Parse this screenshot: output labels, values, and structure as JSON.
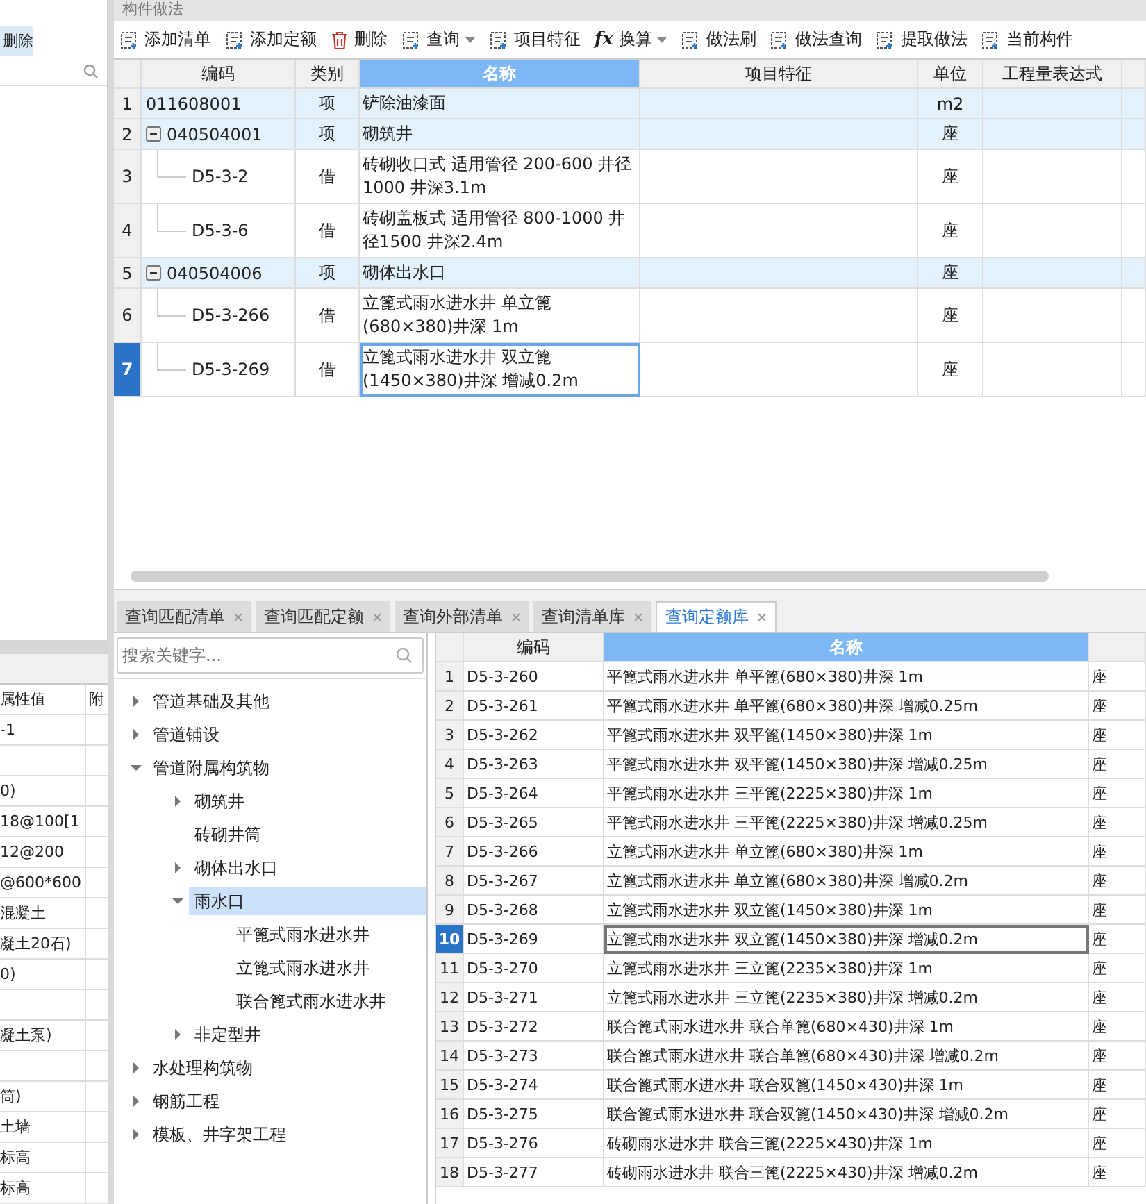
{
  "left_panel": {
    "delete_button": "删除",
    "property_table": {
      "columns": [
        "属性值",
        "附"
      ],
      "rows": [
        {
          "value": "-1"
        },
        {},
        {
          "value": "0)"
        },
        {
          "value": "18@100[1"
        },
        {
          "value": "12@200"
        },
        {
          "value": "@600*600"
        },
        {
          "value": "混凝土"
        },
        {
          "value": "凝土20石)"
        },
        {
          "value": "0)"
        },
        {},
        {
          "value": "凝土泵)"
        },
        {},
        {
          "value": "筒)"
        },
        {
          "value": "土墙"
        },
        {
          "value": "标高"
        },
        {
          "value": "标高"
        }
      ]
    }
  },
  "section_title": "构件做法",
  "toolbar": [
    {
      "label": "添加清单",
      "dropdown": false
    },
    {
      "label": "添加定额",
      "dropdown": false
    },
    {
      "label": "删除",
      "dropdown": false
    },
    {
      "label": "查询",
      "dropdown": true
    },
    {
      "label": "项目特征",
      "dropdown": false
    },
    {
      "label": "换算",
      "glyph": "fx",
      "dropdown": true
    },
    {
      "label": "做法刷",
      "dropdown": false
    },
    {
      "label": "做法查询",
      "dropdown": false
    },
    {
      "label": "提取做法",
      "dropdown": false
    },
    {
      "label": "当前构件",
      "dropdown": false
    }
  ],
  "grid": {
    "columns": [
      {
        "label": "编码",
        "selected": false
      },
      {
        "label": "类别",
        "selected": false
      },
      {
        "label": "名称",
        "selected": true
      },
      {
        "label": "项目特征",
        "selected": false
      },
      {
        "label": "单位",
        "selected": false
      },
      {
        "label": "工程量表达式",
        "selected": false
      }
    ],
    "rows": [
      {
        "num": "1",
        "code": "011608001",
        "type": "项",
        "name": "铲除油漆面",
        "unit": "m2",
        "selected": false
      },
      {
        "num": "2",
        "code": "040504001",
        "type": "项",
        "name": "砌筑井",
        "unit": "座",
        "selected": false,
        "expanded": true,
        "children": [
          {
            "num": "3",
            "code": "D5-3-2",
            "type": "借",
            "name": "砖砌收口式 适用管径 200-600 井径1000 井深3.1m",
            "unit": "座",
            "selected": false
          },
          {
            "num": "4",
            "code": "D5-3-6",
            "type": "借",
            "name": "砖砌盖板式 适用管径 800-1000 井径1500 井深2.4m",
            "unit": "座",
            "selected": false
          }
        ]
      },
      {
        "num": "5",
        "code": "040504006",
        "type": "项",
        "name": "砌体出水口",
        "unit": "座",
        "selected": false,
        "expanded": true,
        "children": [
          {
            "num": "6",
            "code": "D5-3-266",
            "type": "借",
            "name": "立篦式雨水进水井 单立篦(680×380)井深 1m",
            "unit": "座",
            "selected": false
          },
          {
            "num": "7",
            "code": "D5-3-269",
            "type": "借",
            "name": "立篦式雨水进水井 双立篦(1450×380)井深 增减0.2m",
            "unit": "座",
            "selected": true
          }
        ]
      }
    ]
  },
  "bottom_tabs": [
    {
      "label": "查询匹配清单",
      "selected": false
    },
    {
      "label": "查询匹配定额",
      "selected": false
    },
    {
      "label": "查询外部清单",
      "selected": false
    },
    {
      "label": "查询清单库",
      "selected": false
    },
    {
      "label": "查询定额库",
      "selected": true
    }
  ],
  "tree": {
    "placeholder": "搜索关键字...",
    "nodes": [
      {
        "label": "管道基础及其他",
        "expanded": false,
        "selected": false
      },
      {
        "label": "管道铺设",
        "expanded": false,
        "selected": false
      },
      {
        "label": "管道附属构筑物",
        "expanded": true,
        "selected": false,
        "children": [
          {
            "label": "砌筑井",
            "expanded": false,
            "selected": false
          },
          {
            "label": "砖砌井筒",
            "selected": false
          },
          {
            "label": "砌体出水口",
            "expanded": false,
            "selected": false
          },
          {
            "label": "雨水口",
            "expanded": true,
            "selected": true,
            "children": [
              {
                "label": "平篦式雨水进水井",
                "selected": false
              },
              {
                "label": "立篦式雨水进水井",
                "selected": false
              },
              {
                "label": "联合篦式雨水进水井",
                "selected": false
              }
            ]
          },
          {
            "label": "非定型井",
            "expanded": false,
            "selected": false
          }
        ]
      },
      {
        "label": "水处理构筑物",
        "expanded": false,
        "selected": false
      },
      {
        "label": "钢筋工程",
        "expanded": false,
        "selected": false
      },
      {
        "label": "模板、井字架工程",
        "expanded": false,
        "selected": false
      }
    ]
  },
  "quota_table": {
    "columns": [
      {
        "label": "编码",
        "selected": false
      },
      {
        "label": "名称",
        "selected": true
      }
    ],
    "rows": [
      {
        "num": "1",
        "code": "D5-3-260",
        "name": "平篦式雨水进水井 单平篦(680×380)井深 1m",
        "unit": "座",
        "selected": false
      },
      {
        "num": "2",
        "code": "D5-3-261",
        "name": "平篦式雨水进水井 单平篦(680×380)井深 增减0.25m",
        "unit": "座",
        "selected": false
      },
      {
        "num": "3",
        "code": "D5-3-262",
        "name": "平篦式雨水进水井 双平篦(1450×380)井深 1m",
        "unit": "座",
        "selected": false
      },
      {
        "num": "4",
        "code": "D5-3-263",
        "name": "平篦式雨水进水井 双平篦(1450×380)井深 增减0.25m",
        "unit": "座",
        "selected": false
      },
      {
        "num": "5",
        "code": "D5-3-264",
        "name": "平篦式雨水进水井 三平篦(2225×380)井深 1m",
        "unit": "座",
        "selected": false
      },
      {
        "num": "6",
        "code": "D5-3-265",
        "name": "平篦式雨水进水井 三平篦(2225×380)井深 增减0.25m",
        "unit": "座",
        "selected": false
      },
      {
        "num": "7",
        "code": "D5-3-266",
        "name": "立篦式雨水进水井 单立篦(680×380)井深 1m",
        "unit": "座",
        "selected": false
      },
      {
        "num": "8",
        "code": "D5-3-267",
        "name": "立篦式雨水进水井 单立篦(680×380)井深 增减0.2m",
        "unit": "座",
        "selected": false
      },
      {
        "num": "9",
        "code": "D5-3-268",
        "name": "立篦式雨水进水井 双立篦(1450×380)井深 1m",
        "unit": "座",
        "selected": false
      },
      {
        "num": "10",
        "code": "D5-3-269",
        "name": "立篦式雨水进水井 双立篦(1450×380)井深 增减0.2m",
        "unit": "座",
        "selected": true
      },
      {
        "num": "11",
        "code": "D5-3-270",
        "name": "立篦式雨水进水井 三立篦(2235×380)井深 1m",
        "unit": "座",
        "selected": false
      },
      {
        "num": "12",
        "code": "D5-3-271",
        "name": "立篦式雨水进水井 三立篦(2235×380)井深 增减0.2m",
        "unit": "座",
        "selected": false
      },
      {
        "num": "13",
        "code": "D5-3-272",
        "name": "联合篦式雨水进水井 联合单篦(680×430)井深 1m",
        "unit": "座",
        "selected": false
      },
      {
        "num": "14",
        "code": "D5-3-273",
        "name": "联合篦式雨水进水井 联合单篦(680×430)井深 增减0.2m",
        "unit": "座",
        "selected": false
      },
      {
        "num": "15",
        "code": "D5-3-274",
        "name": "联合篦式雨水进水井 联合双篦(1450×430)井深 1m",
        "unit": "座",
        "selected": false
      },
      {
        "num": "16",
        "code": "D5-3-275",
        "name": "联合篦式雨水进水井 联合双篦(1450×430)井深 增减0.2m",
        "unit": "座",
        "selected": false
      },
      {
        "num": "17",
        "code": "D5-3-276",
        "name": "砖砌雨水进水井 联合三篦(2225×430)井深 1m",
        "unit": "座",
        "selected": false
      },
      {
        "num": "18",
        "code": "D5-3-277",
        "name": "砖砌雨水进水井 联合三篦(2225×430)井深 增减0.2m",
        "unit": "座",
        "selected": false
      }
    ]
  }
}
